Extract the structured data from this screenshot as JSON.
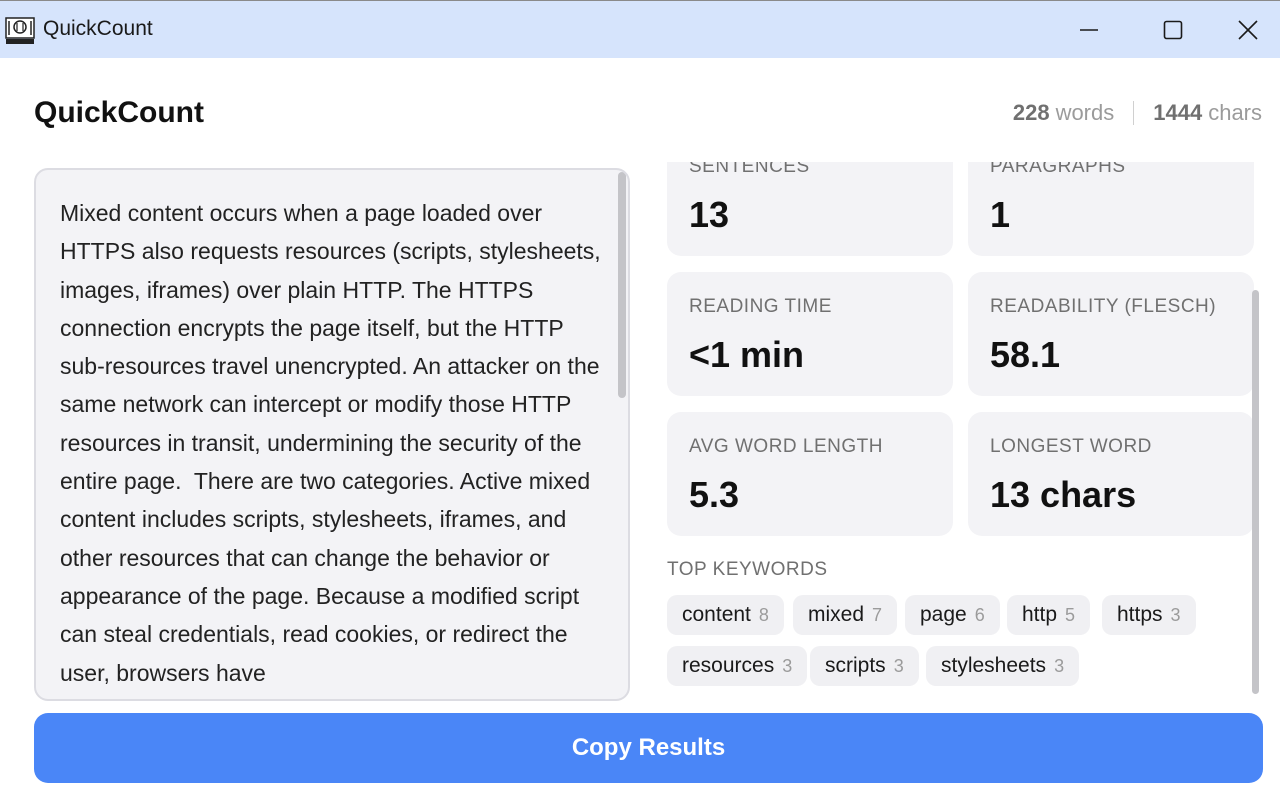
{
  "window": {
    "title": "QuickCount",
    "icon": "app-logo-icon"
  },
  "header": {
    "title": "QuickCount",
    "word_count": "228",
    "word_unit": "words",
    "char_count": "1444",
    "char_unit": "chars"
  },
  "editor": {
    "text": "Mixed content occurs when a page loaded over HTTPS also requests resources (scripts, stylesheets, images, iframes) over plain HTTP. The HTTPS connection encrypts the page itself, but the HTTP sub-resources travel unencrypted. An attacker on the same network can intercept or modify those HTTP resources in transit, undermining the security of the entire page.  There are two categories. Active mixed content includes scripts, stylesheets, iframes, and other resources that can change the behavior or appearance of the page. Because a modified script can steal credentials, read cookies, or redirect the user, browsers have"
  },
  "stats": {
    "sentences": {
      "label": "SENTENCES",
      "value": "13"
    },
    "paragraphs": {
      "label": "PARAGRAPHS",
      "value": "1"
    },
    "reading_time": {
      "label": "READING TIME",
      "value": "<1 min"
    },
    "readability": {
      "label": "READABILITY (FLESCH)",
      "value": "58.1"
    },
    "avg_word_length": {
      "label": "AVG WORD LENGTH",
      "value": "5.3"
    },
    "longest_word": {
      "label": "LONGEST WORD",
      "value": "13 chars"
    }
  },
  "keywords": {
    "label": "TOP KEYWORDS",
    "items": [
      {
        "word": "content",
        "count": "8"
      },
      {
        "word": "mixed",
        "count": "7"
      },
      {
        "word": "page",
        "count": "6"
      },
      {
        "word": "http",
        "count": "5"
      },
      {
        "word": "https",
        "count": "3"
      },
      {
        "word": "resources",
        "count": "3"
      },
      {
        "word": "scripts",
        "count": "3"
      },
      {
        "word": "stylesheets",
        "count": "3"
      }
    ]
  },
  "actions": {
    "copy_label": "Copy Results"
  },
  "colors": {
    "titlebar": "#d6e4fc",
    "accent": "#4a86f7",
    "card": "#f3f3f6"
  }
}
